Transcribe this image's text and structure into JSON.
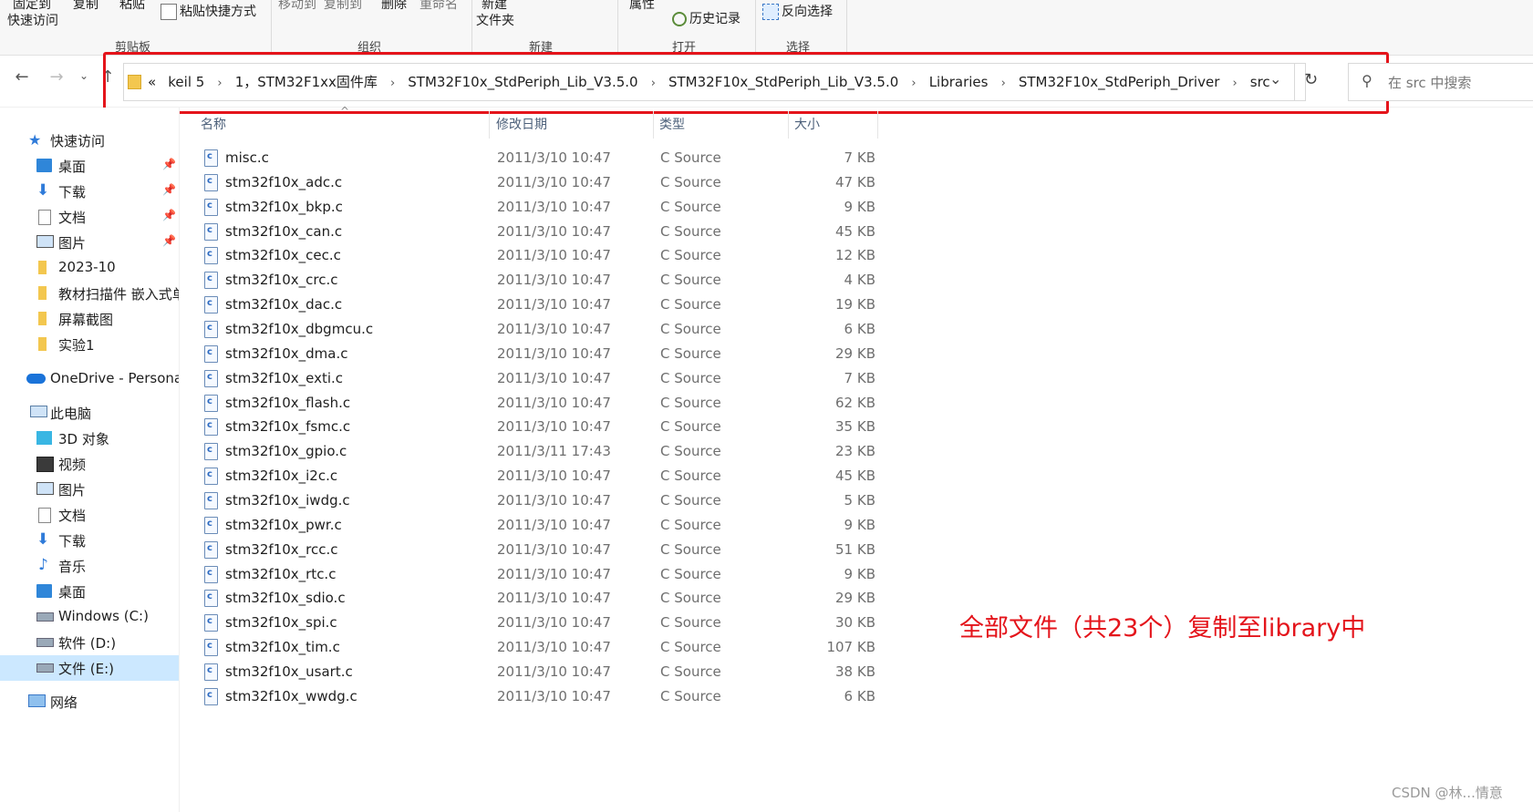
{
  "ribbon": {
    "pin_quick_access": [
      "固定到",
      "快速访问"
    ],
    "copy": "复制",
    "paste": "粘贴",
    "paste_shortcut": "粘贴快捷方式",
    "move_to": "移动到",
    "copy_to": "复制到",
    "delete": "删除",
    "rename": "重命名",
    "new_folder": [
      "新建",
      "文件夹"
    ],
    "properties": "属性",
    "history": "历史记录",
    "invert_selection": "反向选择",
    "groups": {
      "clipboard": "剪贴板",
      "organize": "组织",
      "new": "新建",
      "open": "打开",
      "select": "选择"
    }
  },
  "address": {
    "overflow": "«",
    "crumbs": [
      "keil 5",
      "1，STM32F1xx固件库",
      "STM32F10x_StdPeriph_Lib_V3.5.0",
      "STM32F10x_StdPeriph_Lib_V3.5.0",
      "Libraries",
      "STM32F10x_StdPeriph_Driver",
      "src"
    ],
    "search_placeholder": "在 src 中搜索"
  },
  "sidebar": {
    "items": [
      {
        "label": "快速访问",
        "icon": "star-icon"
      },
      {
        "label": "桌面",
        "icon": "desktop-icon",
        "pinned": true
      },
      {
        "label": "下载",
        "icon": "download-icon",
        "pinned": true
      },
      {
        "label": "文档",
        "icon": "document-icon",
        "pinned": true
      },
      {
        "label": "图片",
        "icon": "picture-icon",
        "pinned": true
      },
      {
        "label": "2023-10",
        "icon": "folder-icon"
      },
      {
        "label": "教材扫描件 嵌入式单",
        "icon": "folder-icon"
      },
      {
        "label": "屏幕截图",
        "icon": "folder-icon"
      },
      {
        "label": "实验1",
        "icon": "folder-icon"
      },
      {
        "label": "OneDrive - Persona",
        "icon": "cloud-icon"
      },
      {
        "label": "此电脑",
        "icon": "computer-icon"
      },
      {
        "label": "3D 对象",
        "icon": "cube-icon"
      },
      {
        "label": "视频",
        "icon": "video-icon"
      },
      {
        "label": "图片",
        "icon": "picture-icon"
      },
      {
        "label": "文档",
        "icon": "document-icon"
      },
      {
        "label": "下载",
        "icon": "download-icon"
      },
      {
        "label": "音乐",
        "icon": "music-icon"
      },
      {
        "label": "桌面",
        "icon": "desktop-icon"
      },
      {
        "label": "Windows (C:)",
        "icon": "drive-icon"
      },
      {
        "label": "软件 (D:)",
        "icon": "drive-icon"
      },
      {
        "label": "文件 (E:)",
        "icon": "drive-icon",
        "selected": true
      },
      {
        "label": "网络",
        "icon": "network-icon"
      }
    ]
  },
  "columns": {
    "name": "名称",
    "date": "修改日期",
    "type": "类型",
    "size": "大小"
  },
  "files": [
    {
      "name": "misc.c",
      "date": "2011/3/10 10:47",
      "type": "C Source",
      "size": "7 KB"
    },
    {
      "name": "stm32f10x_adc.c",
      "date": "2011/3/10 10:47",
      "type": "C Source",
      "size": "47 KB"
    },
    {
      "name": "stm32f10x_bkp.c",
      "date": "2011/3/10 10:47",
      "type": "C Source",
      "size": "9 KB"
    },
    {
      "name": "stm32f10x_can.c",
      "date": "2011/3/10 10:47",
      "type": "C Source",
      "size": "45 KB"
    },
    {
      "name": "stm32f10x_cec.c",
      "date": "2011/3/10 10:47",
      "type": "C Source",
      "size": "12 KB"
    },
    {
      "name": "stm32f10x_crc.c",
      "date": "2011/3/10 10:47",
      "type": "C Source",
      "size": "4 KB"
    },
    {
      "name": "stm32f10x_dac.c",
      "date": "2011/3/10 10:47",
      "type": "C Source",
      "size": "19 KB"
    },
    {
      "name": "stm32f10x_dbgmcu.c",
      "date": "2011/3/10 10:47",
      "type": "C Source",
      "size": "6 KB"
    },
    {
      "name": "stm32f10x_dma.c",
      "date": "2011/3/10 10:47",
      "type": "C Source",
      "size": "29 KB"
    },
    {
      "name": "stm32f10x_exti.c",
      "date": "2011/3/10 10:47",
      "type": "C Source",
      "size": "7 KB"
    },
    {
      "name": "stm32f10x_flash.c",
      "date": "2011/3/10 10:47",
      "type": "C Source",
      "size": "62 KB"
    },
    {
      "name": "stm32f10x_fsmc.c",
      "date": "2011/3/10 10:47",
      "type": "C Source",
      "size": "35 KB"
    },
    {
      "name": "stm32f10x_gpio.c",
      "date": "2011/3/11 17:43",
      "type": "C Source",
      "size": "23 KB"
    },
    {
      "name": "stm32f10x_i2c.c",
      "date": "2011/3/10 10:47",
      "type": "C Source",
      "size": "45 KB"
    },
    {
      "name": "stm32f10x_iwdg.c",
      "date": "2011/3/10 10:47",
      "type": "C Source",
      "size": "5 KB"
    },
    {
      "name": "stm32f10x_pwr.c",
      "date": "2011/3/10 10:47",
      "type": "C Source",
      "size": "9 KB"
    },
    {
      "name": "stm32f10x_rcc.c",
      "date": "2011/3/10 10:47",
      "type": "C Source",
      "size": "51 KB"
    },
    {
      "name": "stm32f10x_rtc.c",
      "date": "2011/3/10 10:47",
      "type": "C Source",
      "size": "9 KB"
    },
    {
      "name": "stm32f10x_sdio.c",
      "date": "2011/3/10 10:47",
      "type": "C Source",
      "size": "29 KB"
    },
    {
      "name": "stm32f10x_spi.c",
      "date": "2011/3/10 10:47",
      "type": "C Source",
      "size": "30 KB"
    },
    {
      "name": "stm32f10x_tim.c",
      "date": "2011/3/10 10:47",
      "type": "C Source",
      "size": "107 KB"
    },
    {
      "name": "stm32f10x_usart.c",
      "date": "2011/3/10 10:47",
      "type": "C Source",
      "size": "38 KB"
    },
    {
      "name": "stm32f10x_wwdg.c",
      "date": "2011/3/10 10:47",
      "type": "C Source",
      "size": "6 KB"
    }
  ],
  "annotation": "全部文件（共23个）复制至library中",
  "watermark": "CSDN @林...情意",
  "colors": {
    "highlight": "#e4141b",
    "selected": "#e5f3ff",
    "file_icon": "#2d6bc2"
  }
}
